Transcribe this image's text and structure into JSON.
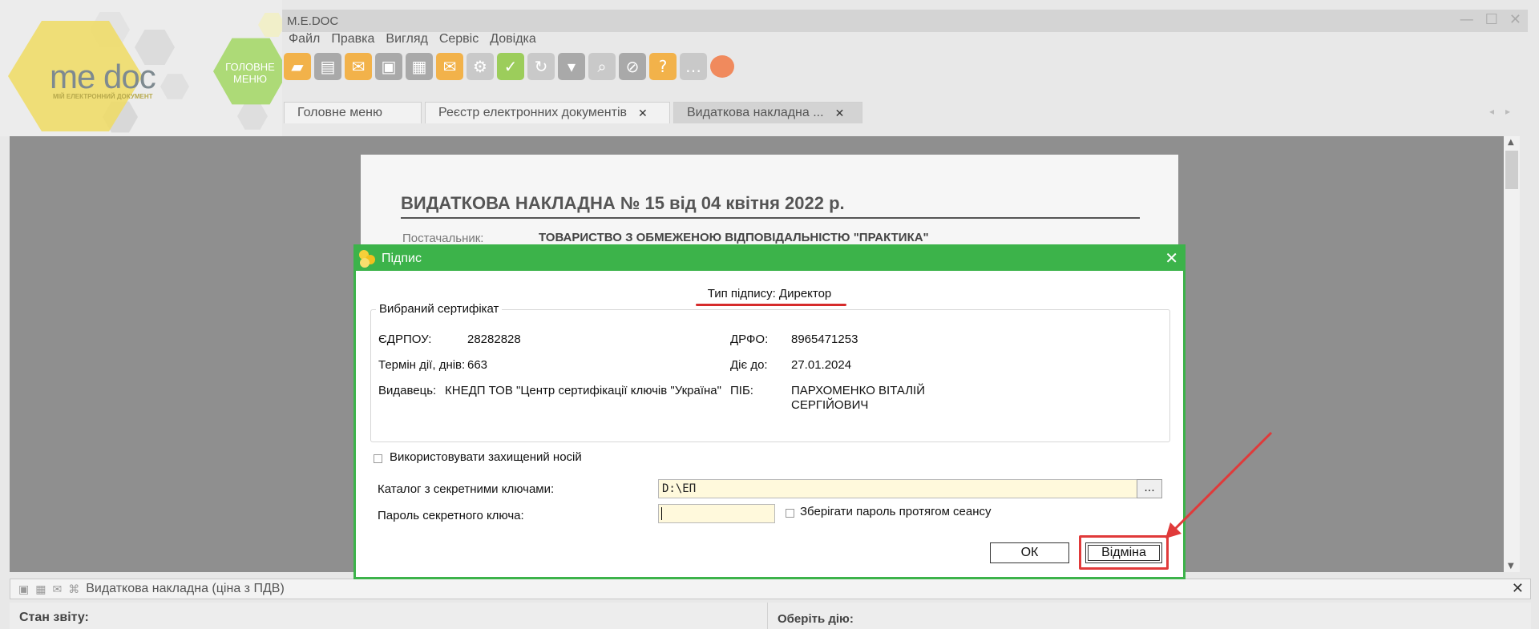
{
  "app": {
    "title": "M.E.DOC",
    "logo_text": "me doc",
    "logo_subtitle": "МІЙ ЕЛЕКТРОННИЙ ДОКУМЕНТ",
    "main_menu_hex": "ГОЛОВНЕ МЕНЮ"
  },
  "menu": [
    "Файл",
    "Правка",
    "Вигляд",
    "Сервіс",
    "Довідка"
  ],
  "tabs": [
    {
      "label": "Головне меню",
      "closable": false
    },
    {
      "label": "Реєстр електронних документів",
      "closable": true
    },
    {
      "label": "Видаткова накладна ...",
      "closable": true
    }
  ],
  "document": {
    "title": "ВИДАТКОВА НАКЛАДНА №  15 від 04 квітня 2022 р.",
    "supplier_label": "Постачальник:",
    "supplier_value": "ТОВАРИСТВО З ОБМЕЖЕНОЮ ВІДПОВІДАЛЬНІСТЮ \"ПРАКТИКА\""
  },
  "dialog": {
    "title": "Підпис",
    "sign_type": "Тип підпису: Директор",
    "cert_legend": "Вибраний сертифікат",
    "edrpou_label": "ЄДРПОУ:",
    "edrpou_value": "28282828",
    "drfo_label": "ДРФО:",
    "drfo_value": "8965471253",
    "term_label": "Термін дії, днів:",
    "term_value": "663",
    "valid_to_label": "Діє до:",
    "valid_to_value": "27.01.2024",
    "issuer_label": "Видавець:",
    "issuer_value": "КНЕДП ТОВ \"Центр сертифікації ключів \"Україна\"",
    "pib_label": "ПІБ:",
    "pib_value_line1": "ПАРХОМЕНКО ВІТАЛІЙ",
    "pib_value_line2": "СЕРГІЙОВИЧ",
    "use_protected_label": "Використовувати захищений носій",
    "keys_dir_label": "Каталог з секретними ключами:",
    "keys_dir_value": "D:\\ЕП",
    "browse_label": "...",
    "password_label": "Пароль секретного ключа:",
    "password_value": "",
    "save_password_label": "Зберігати пароль протягом сеансу",
    "ok_label": "ОК",
    "cancel_label": "Відміна"
  },
  "status": {
    "doc_name": "Видаткова накладна (ціна з ПДВ)",
    "state_label": "Стан звіту:",
    "action_label": "Оберіть дію:"
  },
  "colors": {
    "dialog_accent": "#3cb34a",
    "highlight": "#e03a3a",
    "input_bg": "#fff9dc"
  }
}
